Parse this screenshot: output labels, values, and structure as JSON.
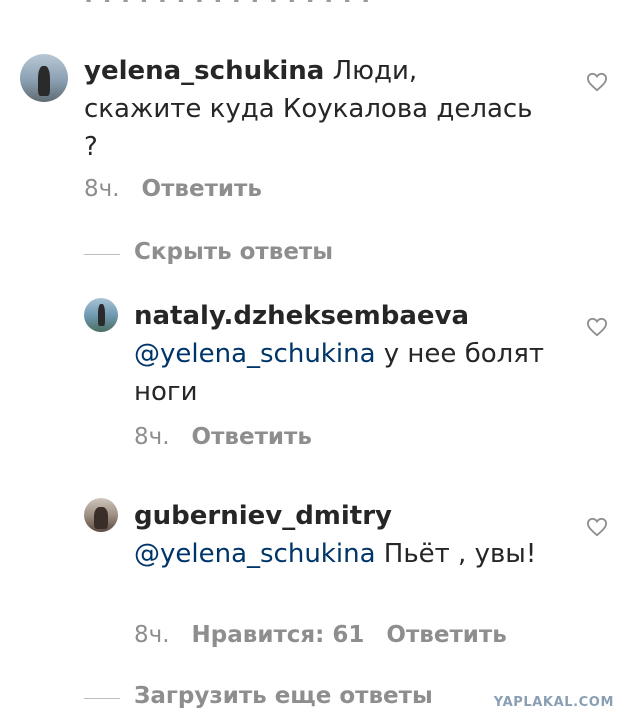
{
  "comments": [
    {
      "username": "yelena_schukina",
      "text": " Люди, скажите куда Коукалова делась ?",
      "time": "8ч.",
      "reply": "Ответить"
    },
    {
      "username": "nataly.dzheksembaeva",
      "mention": "@yelena_schukina",
      "text": " у нее болят ноги",
      "time": "8ч.",
      "reply": "Ответить"
    },
    {
      "username": "guberniev_dmitry",
      "mention": "@yelena_schukina",
      "text": " Пьёт , увы!",
      "time": "8ч.",
      "likes": "Нравится: 61",
      "reply": "Ответить"
    }
  ],
  "hide_replies": "Скрыть ответы",
  "load_more_replies": "Загрузить еще ответы",
  "watermark": "YAPLAKAL.COM",
  "icons": [
    "heart-icon",
    "avatar"
  ]
}
